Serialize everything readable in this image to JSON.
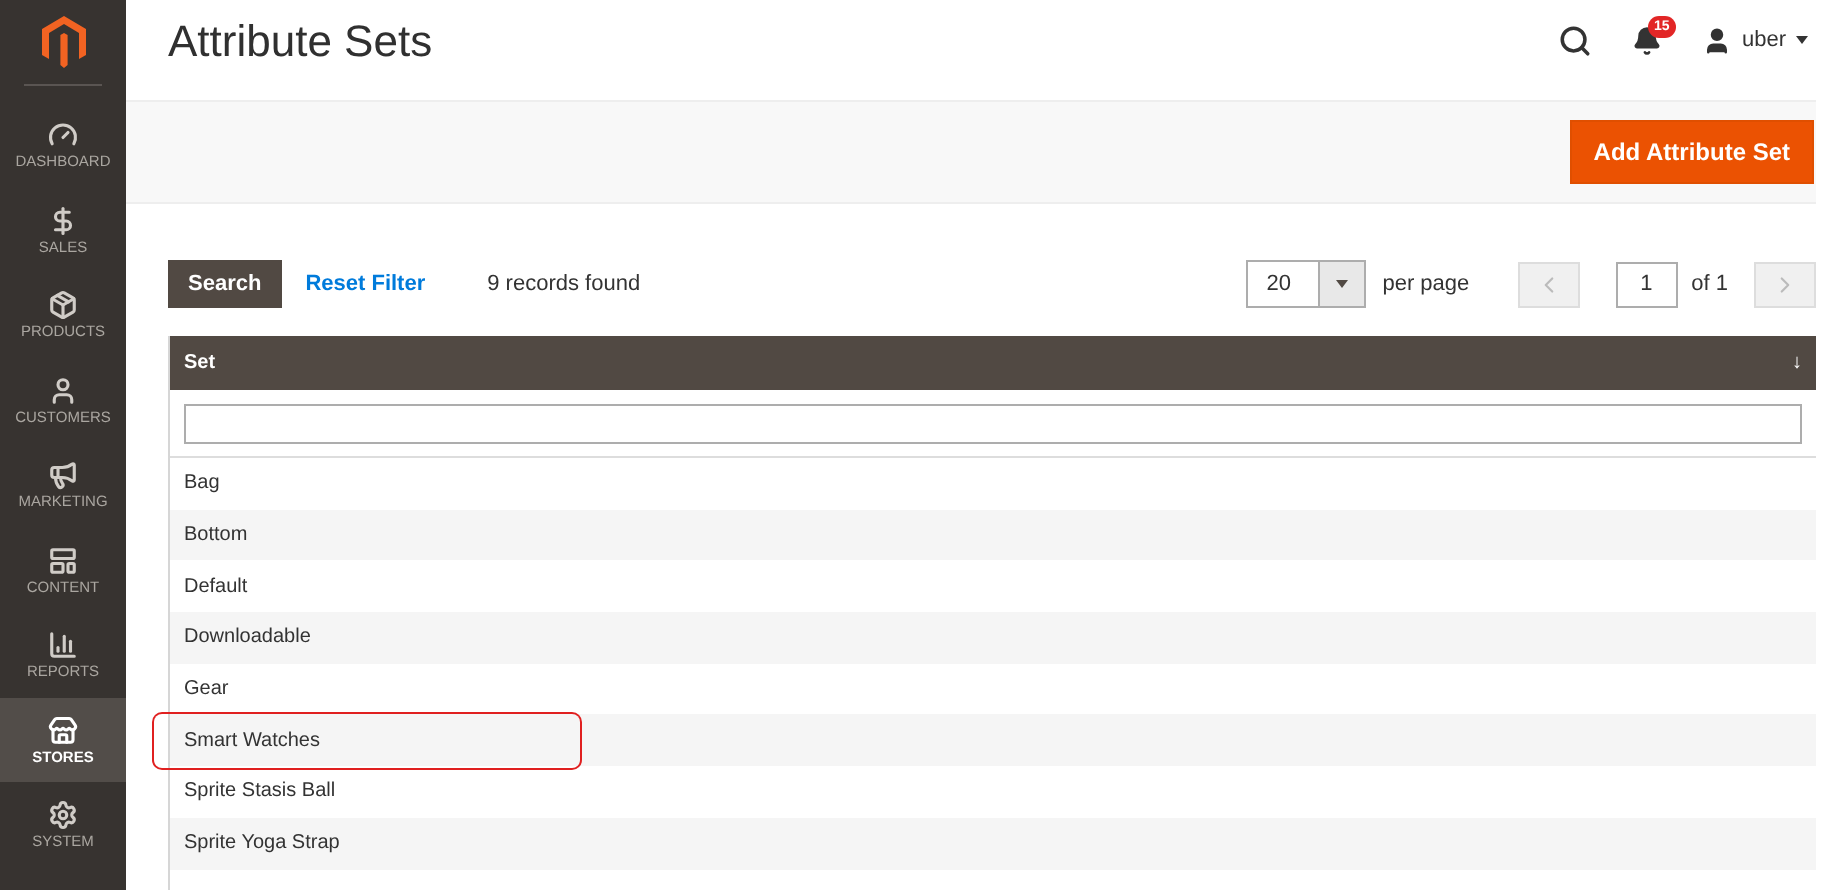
{
  "page_title": "Attribute Sets",
  "header": {
    "notifications": "15",
    "user": "uber"
  },
  "sidebar": {
    "items": [
      {
        "kind": "dashboard",
        "label": "DASHBOARD",
        "selected": false
      },
      {
        "kind": "sales",
        "label": "SALES",
        "selected": false
      },
      {
        "kind": "products",
        "label": "PRODUCTS",
        "selected": false
      },
      {
        "kind": "customers",
        "label": "CUSTOMERS",
        "selected": false
      },
      {
        "kind": "marketing",
        "label": "MARKETING",
        "selected": false
      },
      {
        "kind": "content",
        "label": "CONTENT",
        "selected": false
      },
      {
        "kind": "reports",
        "label": "REPORTS",
        "selected": false
      },
      {
        "kind": "stores",
        "label": "STORES",
        "selected": true
      },
      {
        "kind": "system",
        "label": "SYSTEM",
        "selected": false
      }
    ]
  },
  "add_button": "Add Attribute Set",
  "toolbar": {
    "search": "Search",
    "reset": "Reset Filter",
    "records": "9 records found",
    "per_page_value": "20",
    "per_page_label": "per page",
    "page": "1",
    "of": "of 1"
  },
  "table": {
    "columns": [
      {
        "label": "Set",
        "sort": "↓"
      }
    ],
    "rows": [
      {
        "set": "Bag",
        "highlighted": false
      },
      {
        "set": "Bottom",
        "highlighted": false
      },
      {
        "set": "Default",
        "highlighted": false
      },
      {
        "set": "Downloadable",
        "highlighted": false
      },
      {
        "set": "Gear",
        "highlighted": false
      },
      {
        "set": "Smart Watches",
        "highlighted": true
      },
      {
        "set": "Sprite Stasis Ball",
        "highlighted": false
      },
      {
        "set": "Sprite Yoga Strap",
        "highlighted": false
      }
    ]
  }
}
